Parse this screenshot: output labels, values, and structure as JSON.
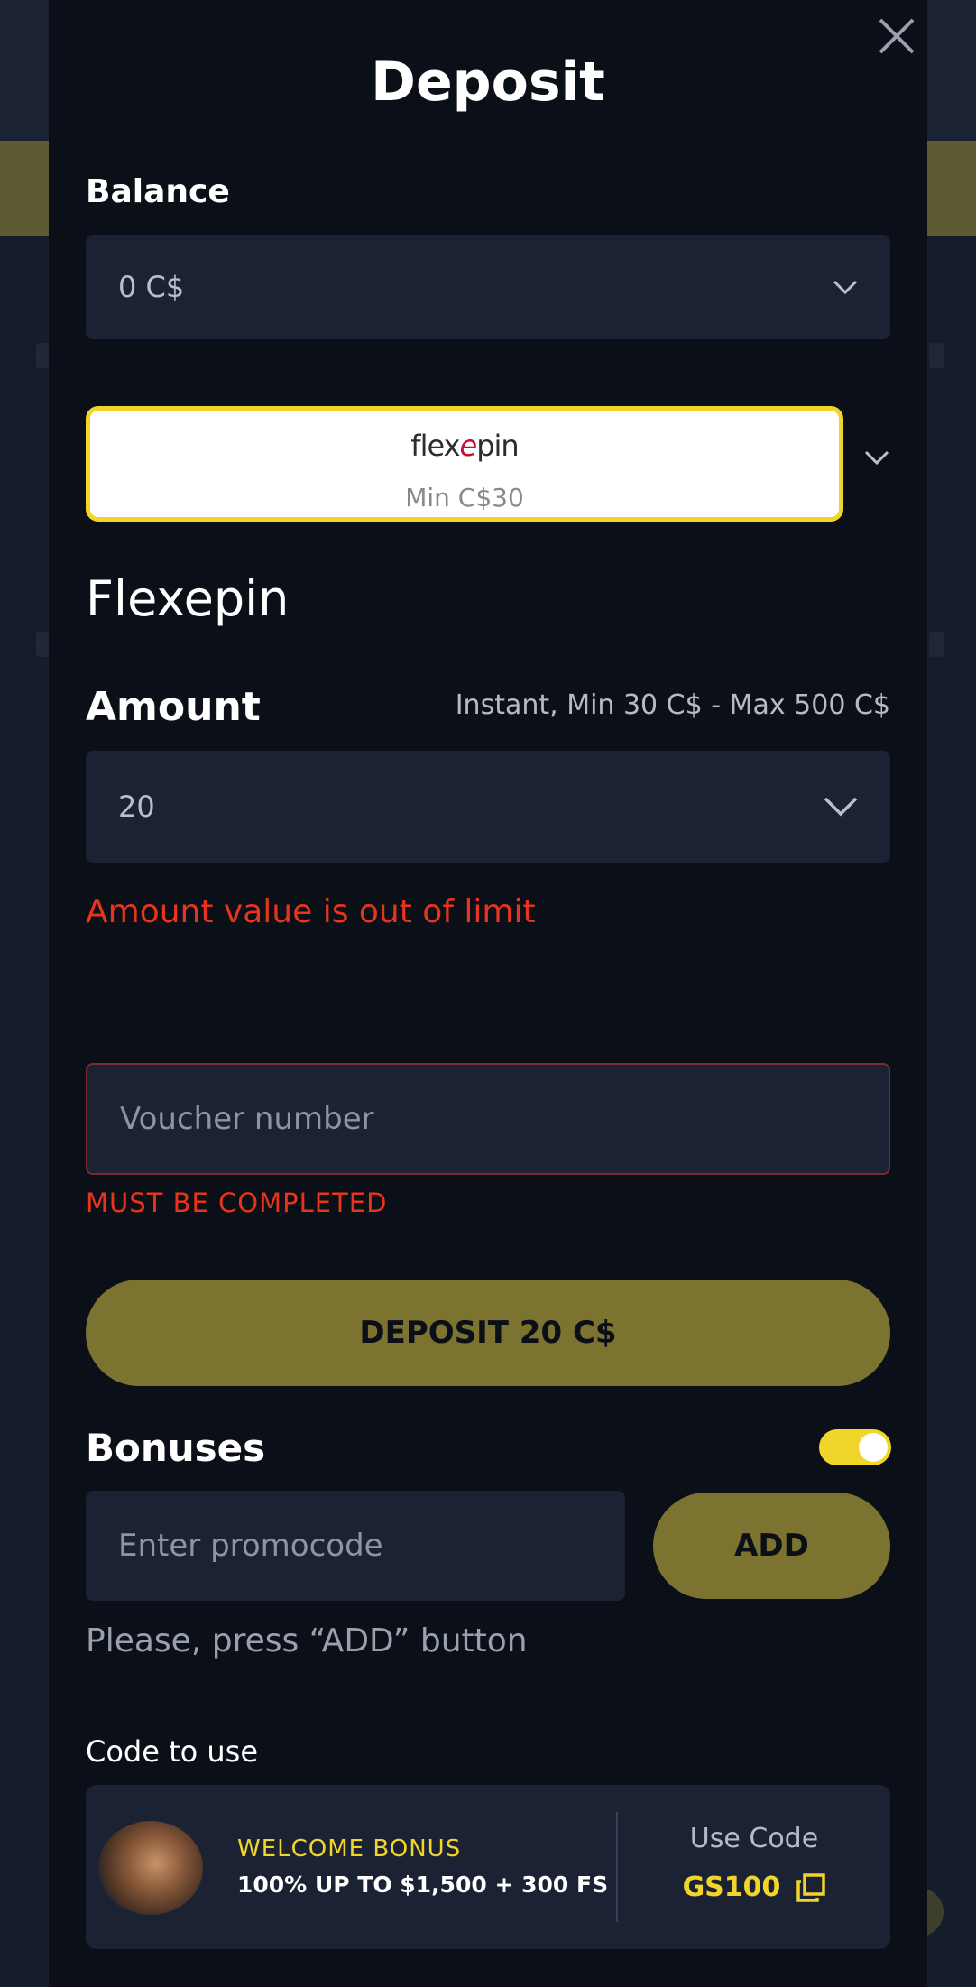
{
  "modal": {
    "title": "Deposit",
    "balance": {
      "label": "Balance",
      "value": "0 C$"
    },
    "payment_method": {
      "logo_prefix": "flex",
      "logo_accent": "e",
      "logo_suffix": "pin",
      "min_text": "Min C$30",
      "name": "Flexepin"
    },
    "amount": {
      "label": "Amount",
      "hint": "Instant, Min 30 C$ - Max 500 C$",
      "value": "20",
      "error": "Amount value is out of limit"
    },
    "voucher": {
      "placeholder": "Voucher number",
      "error": "MUST BE COMPLETED"
    },
    "deposit_button": "DEPOSIT 20 C$",
    "bonuses": {
      "label": "Bonuses",
      "toggle_on": true,
      "promo_placeholder": "Enter promocode",
      "add_button": "ADD",
      "hint": "Please, press “ADD” button"
    },
    "code_to_use": {
      "label": "Code to use",
      "bonus_title": "WELCOME BONUS",
      "bonus_desc": "100% UP TO $1,500 + 300 FS",
      "use_code_label": "Use Code",
      "code": "GS100"
    }
  },
  "colors": {
    "accent_yellow": "#f1d52a",
    "button_olive": "#7d7330",
    "error_red": "#e6341d",
    "field_bg": "#1a2234",
    "modal_bg": "#0b0f17"
  }
}
